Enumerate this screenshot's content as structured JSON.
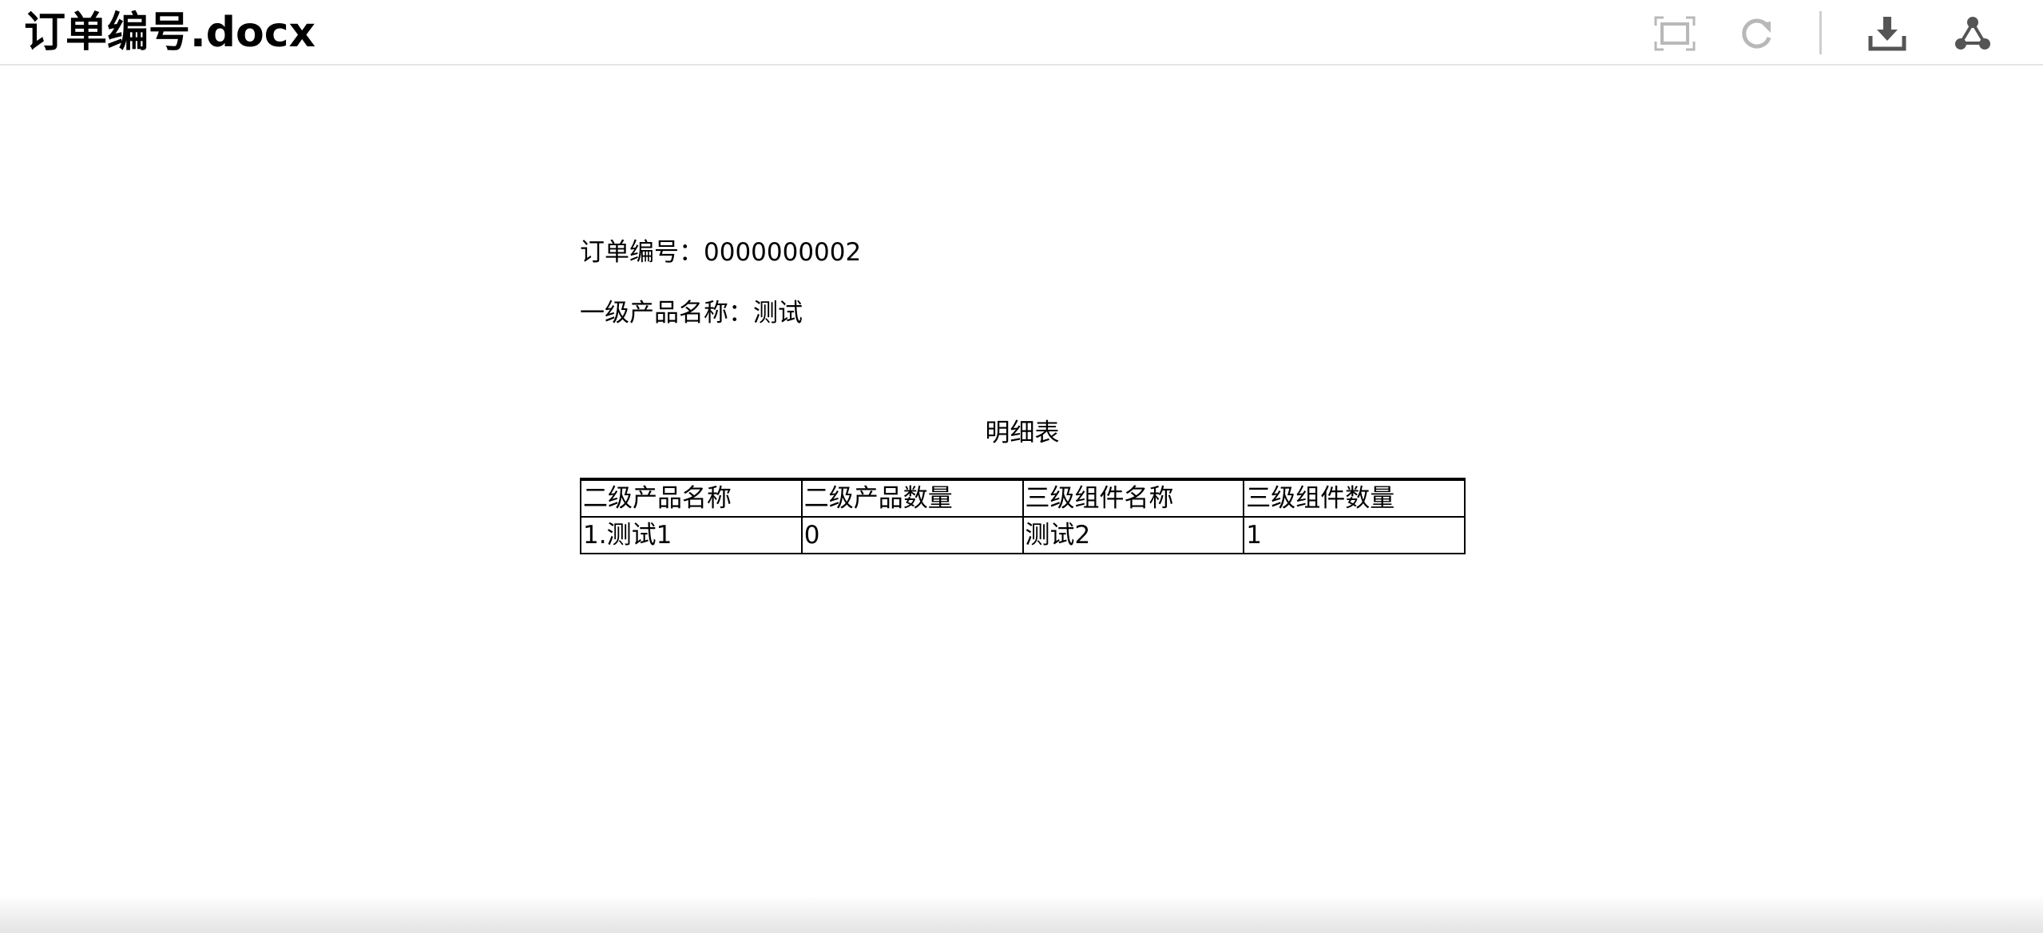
{
  "header": {
    "title": "订单编号.docx",
    "icons": {
      "fit": "fit-screen-icon",
      "redo": "redo-icon",
      "download": "download-icon",
      "share": "share-icon"
    }
  },
  "document": {
    "order_line": "订单编号：0000000002",
    "product_line": "一级产品名称：测试",
    "table_caption": "明细表",
    "table": {
      "headers": [
        "二级产品名称",
        "二级产品数量",
        "三级组件名称",
        "三级组件数量"
      ],
      "rows": [
        [
          "1.测试1",
          "0",
          "测试2",
          "1"
        ]
      ]
    }
  },
  "colors": {
    "icon_active": "#555555",
    "icon_disabled": "#b8b8b8",
    "divider": "#cfcfcf",
    "header_border": "#e5e5e5"
  }
}
